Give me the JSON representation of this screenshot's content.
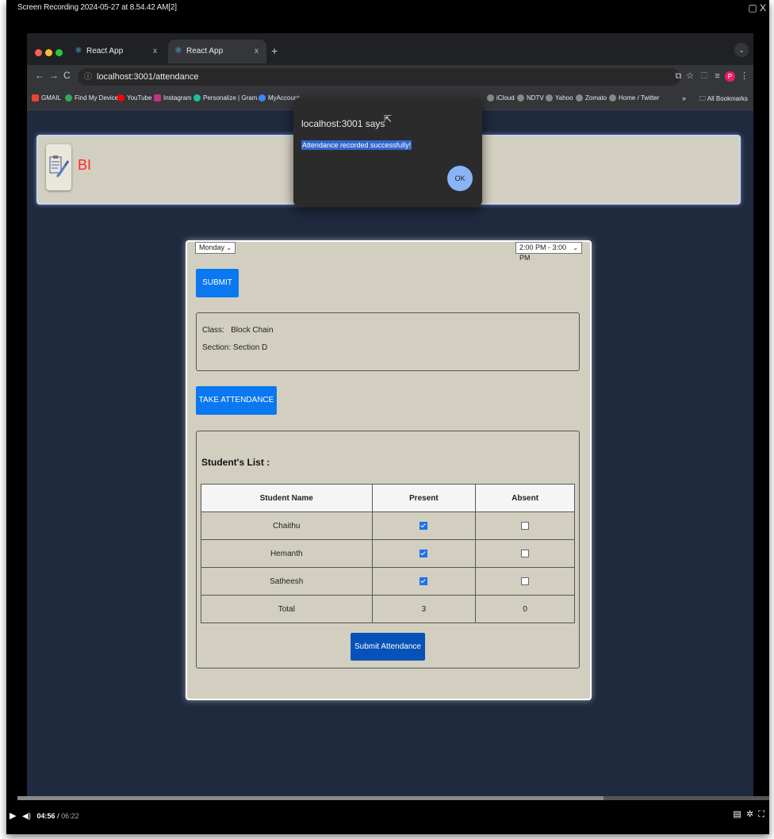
{
  "recording": {
    "title": "Screen Recording 2024-05-27 at 8.54.42 AM[2]",
    "top_icons": "▢ X"
  },
  "browser": {
    "tabs": [
      {
        "label": "React App",
        "close": "x"
      },
      {
        "label": "React App",
        "close": "x"
      }
    ],
    "new_tab": "+",
    "tab_menu": "⌄",
    "nav": {
      "back": "←",
      "forward": "→",
      "reload": "C"
    },
    "url": "localhost:3001/attendance",
    "bookmarks": [
      {
        "label": "GMAIL",
        "color": "#ea4335"
      },
      {
        "label": "Find My Device",
        "color": "#34a853"
      },
      {
        "label": "YouTube",
        "color": "#ff0000"
      },
      {
        "label": "Instagram",
        "color": "#c13584"
      },
      {
        "label": "Personalize | Gram...",
        "color": "#15c39a"
      },
      {
        "label": "MyAccount",
        "color": "#4285f4"
      },
      {
        "label": "iCloud",
        "color": "#888888"
      },
      {
        "label": "NDTV",
        "color": "#888888"
      },
      {
        "label": "Yahoo",
        "color": "#888888"
      },
      {
        "label": "Zomato",
        "color": "#888888"
      },
      {
        "label": "Home / Twitter",
        "color": "#888888"
      }
    ],
    "bookmarks_overflow": "»",
    "all_bookmarks": "All Bookmarks",
    "profile_letter": "P"
  },
  "app": {
    "brand": "BI",
    "day_select": "Monday",
    "time_select": "2:00 PM - 3:00 PM",
    "submit_label": "SUBMIT",
    "class_label": "Class:",
    "class_value": "Block Chain",
    "section_label": "Section:",
    "section_value": "Section D",
    "take_attendance_label": "TAKE ATTENDANCE",
    "list_title": "Student's List :",
    "table": {
      "headers": [
        "Student Name",
        "Present",
        "Absent"
      ],
      "rows": [
        {
          "name": "Chaithu",
          "present": true,
          "absent": false
        },
        {
          "name": "Hemanth",
          "present": true,
          "absent": false
        },
        {
          "name": "Satheesh",
          "present": true,
          "absent": false
        }
      ],
      "total": {
        "label": "Total",
        "present": "3",
        "absent": "0"
      }
    },
    "submit_attendance_label": "Submit Attendance"
  },
  "dialog": {
    "title": "localhost:3001 says",
    "message": "Attendance recorded successfully!",
    "ok_label": "OK"
  },
  "player": {
    "time_current": "04:56",
    "time_total": "06:22",
    "progress_fraction": 0.78
  },
  "colors": {
    "primary": "#0a78f0",
    "submit": "#0652b8",
    "page_bg": "#1f2a3f",
    "card_bg": "#d3cfc0",
    "brand": "#ff2a2a"
  }
}
